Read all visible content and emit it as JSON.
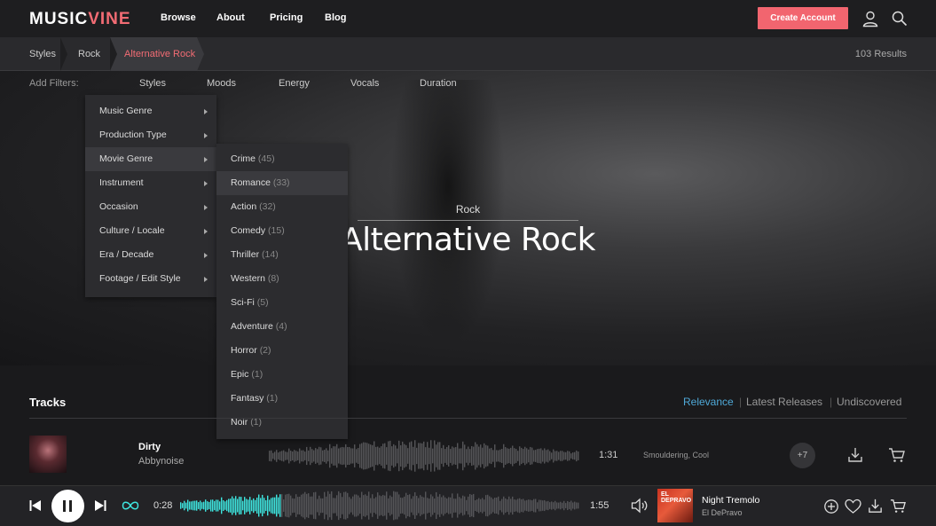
{
  "header": {
    "logo_part1": "MUSIC",
    "logo_part2": "VINE",
    "nav": [
      "Browse",
      "About",
      "Pricing",
      "Blog"
    ],
    "create_account": "Create Account"
  },
  "breadcrumb": {
    "items": [
      "Styles",
      "Rock",
      "Alternative Rock"
    ],
    "results": "103 Results"
  },
  "filters": {
    "label": "Add Filters:",
    "tabs": [
      "Styles",
      "Moods",
      "Energy",
      "Vocals",
      "Duration"
    ]
  },
  "hero": {
    "kicker": "Rock",
    "title": "Alternative Rock"
  },
  "styles_menu": {
    "items": [
      "Music Genre",
      "Production Type",
      "Movie Genre",
      "Instrument",
      "Occasion",
      "Culture / Locale",
      "Era / Decade",
      "Footage / Edit Style"
    ],
    "highlighted": "Movie Genre"
  },
  "movie_genre_menu": {
    "items": [
      {
        "label": "Crime",
        "count": "(45)"
      },
      {
        "label": "Romance",
        "count": "(33)"
      },
      {
        "label": "Action",
        "count": "(32)"
      },
      {
        "label": "Comedy",
        "count": "(15)"
      },
      {
        "label": "Thriller",
        "count": "(14)"
      },
      {
        "label": "Western",
        "count": "(8)"
      },
      {
        "label": "Sci-Fi",
        "count": "(5)"
      },
      {
        "label": "Adventure",
        "count": "(4)"
      },
      {
        "label": "Horror",
        "count": "(2)"
      },
      {
        "label": "Epic",
        "count": "(1)"
      },
      {
        "label": "Fantasy",
        "count": "(1)"
      },
      {
        "label": "Noir",
        "count": "(1)"
      }
    ],
    "highlighted": "Romance"
  },
  "tracks": {
    "heading": "Tracks",
    "sort": [
      "Relevance",
      "Latest Releases",
      "Undiscovered"
    ],
    "active_sort": "Relevance",
    "rows": [
      {
        "title": "Dirty",
        "artist": "Abbynoise",
        "duration": "1:31",
        "tags": "Smouldering, Cool",
        "more": "+7"
      }
    ]
  },
  "player": {
    "current_time": "0:28",
    "total_time": "1:55",
    "progress": 0.25,
    "now_playing_title": "Night Tremolo",
    "now_playing_artist": "El DePravo",
    "cover_text": "EL DEPRAVO"
  },
  "colors": {
    "accent": "#f2656f",
    "sort_active": "#4fa9d8",
    "waveform_played": "#3ee6e0",
    "waveform_unplayed": "#555558"
  },
  "icons": [
    "user-icon",
    "search-icon",
    "download-icon",
    "cart-icon",
    "skip-back-icon",
    "pause-icon",
    "skip-forward-icon",
    "loop-icon",
    "volume-icon",
    "add-circle-icon",
    "heart-icon"
  ]
}
